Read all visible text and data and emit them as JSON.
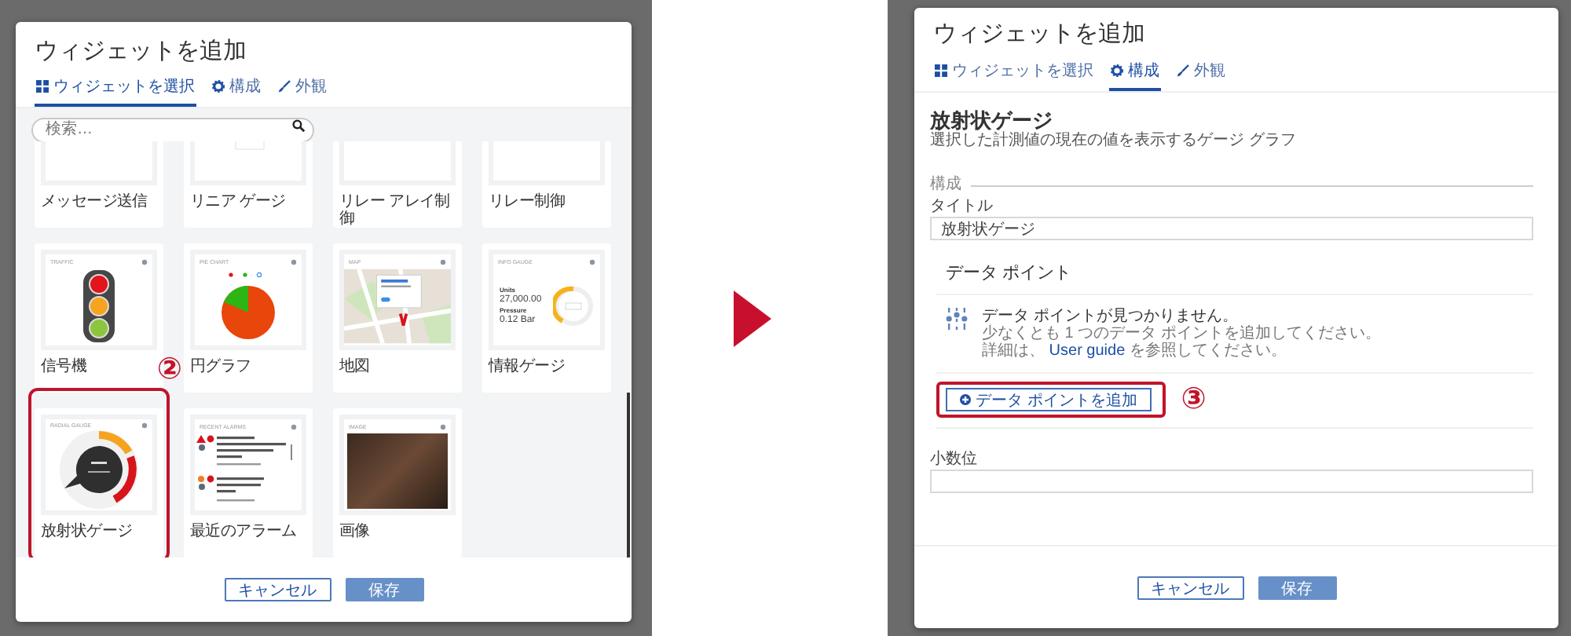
{
  "left_dialog": {
    "title": "ウィジェットを追加",
    "tabs": [
      {
        "label": "ウィジェットを選択",
        "selected": true
      },
      {
        "label": "構成",
        "selected": false
      },
      {
        "label": "外観",
        "selected": false
      }
    ],
    "search": {
      "placeholder": "検索…"
    },
    "widgets": [
      {
        "label": "メッセージ送信",
        "kind": "blank",
        "highlighted": false
      },
      {
        "label": "リニア ゲージ",
        "kind": "linear",
        "highlighted": false
      },
      {
        "label": "リレー アレイ制御",
        "kind": "blank",
        "highlighted": false
      },
      {
        "label": "リレー制御",
        "kind": "blank",
        "highlighted": false
      },
      {
        "label": "信号機",
        "kind": "traffic",
        "preview_title": "TRAFFIC",
        "highlighted": false
      },
      {
        "label": "円グラフ",
        "kind": "pie",
        "preview_title": "PIE CHART",
        "highlighted": false
      },
      {
        "label": "地図",
        "kind": "map",
        "preview_title": "MAP",
        "highlighted": false
      },
      {
        "label": "情報ゲージ",
        "kind": "info",
        "preview_title": "INFO GAUGE",
        "preview_texts": [
          "Units",
          "27,000.00",
          "Pressure",
          "0.12 Bar"
        ],
        "highlighted": false
      },
      {
        "label": "放射状ゲージ",
        "kind": "radial",
        "preview_title": "RADIAL GAUGE",
        "highlighted": true,
        "callout": "②"
      },
      {
        "label": "最近のアラーム",
        "kind": "alarms",
        "preview_title": "RECENT ALARMS",
        "highlighted": false
      },
      {
        "label": "画像",
        "kind": "image",
        "preview_title": "IMAGE",
        "highlighted": false
      }
    ],
    "buttons": [
      {
        "label": "キャンセル",
        "kind": "secondary"
      },
      {
        "label": "保存",
        "kind": "primary"
      }
    ]
  },
  "right_dialog": {
    "title": "ウィジェットを追加",
    "tabs": [
      {
        "label": "ウィジェットを選択",
        "selected": false
      },
      {
        "label": "構成",
        "selected": true
      },
      {
        "label": "外観",
        "selected": false
      }
    ],
    "widget_name": "放射状ゲージ",
    "widget_description": "選択した計測値の現在の値を表示するゲージ グラフ",
    "section_label": "構成",
    "title_field": {
      "label": "タイトル",
      "value": "放射状ゲージ"
    },
    "data_points": {
      "heading": "データ ポイント",
      "empty_title": "データ ポイントが見つかりません。",
      "empty_hint": "少なくとも 1 つのデータ ポイントを追加してください。",
      "guide_before": "詳細は、",
      "guide_link": "User guide",
      "guide_after": "を参照してください。",
      "add_button": {
        "label": "データ ポイントを追加",
        "highlighted": true,
        "callout": "③"
      }
    },
    "decimals_field": {
      "label": "小数位"
    },
    "buttons": [
      {
        "label": "キャンセル",
        "kind": "secondary"
      },
      {
        "label": "保存",
        "kind": "primary"
      }
    ]
  }
}
